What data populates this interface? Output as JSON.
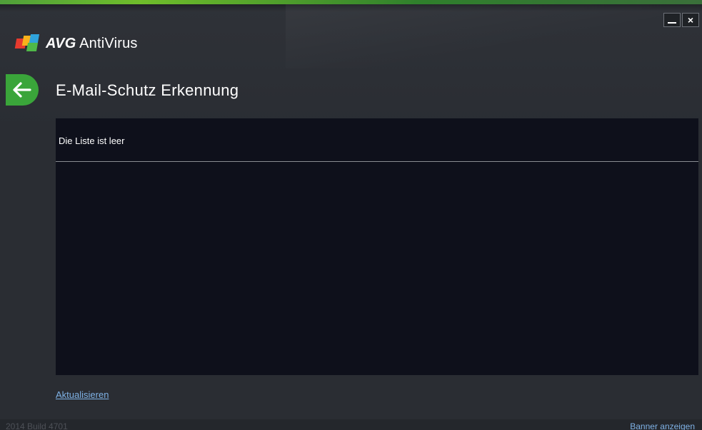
{
  "app": {
    "brand": "AVG",
    "product": "AntiVirus"
  },
  "window_controls": {
    "minimize_icon": "minimize-icon",
    "close_icon": "close-icon",
    "close_glyph": "×"
  },
  "page": {
    "back_icon": "arrow-left-icon",
    "title": "E-Mail-Schutz Erkennung"
  },
  "list": {
    "empty_message": "Die Liste ist leer",
    "rows": []
  },
  "actions": {
    "refresh_label": "Aktualisieren"
  },
  "footer": {
    "build": "2014 Build 4701",
    "banner_label": "Banner anzeigen"
  },
  "colors": {
    "accent_green": "#3aa53a",
    "link_blue": "#7fb2e6",
    "panel_bg": "#0e101b",
    "window_bg": "#2a2d33"
  }
}
